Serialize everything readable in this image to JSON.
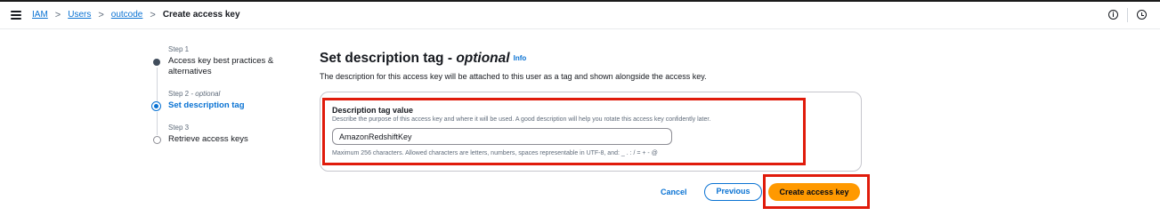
{
  "header": {
    "breadcrumbs": [
      {
        "label": "IAM"
      },
      {
        "label": "Users"
      },
      {
        "label": "outcode"
      }
    ],
    "current": "Create access key",
    "separator": ">",
    "info_icon": "i"
  },
  "steps": [
    {
      "number": "Step 1",
      "title_line1": "Access key best practices &",
      "title_line2": "alternatives",
      "state": "done"
    },
    {
      "number": "Step 2",
      "number_suffix": " - optional",
      "title": "Set description tag",
      "state": "active"
    },
    {
      "number": "Step 3",
      "title": "Retrieve access keys",
      "state": "pending"
    }
  ],
  "main": {
    "title": "Set description tag - ",
    "title_optional": "optional",
    "info": "Info",
    "description": "The description for this access key will be attached to this user as a tag and shown alongside the access key."
  },
  "field": {
    "label": "Description tag value",
    "description": "Describe the purpose of this access key and where it will be used. A good description will help you rotate this access key confidently later.",
    "value": "AmazonRedshiftKey",
    "constraint": "Maximum 256 characters. Allowed characters are letters, numbers, spaces representable in UTF-8, and: _ . : / = + - @"
  },
  "actions": {
    "cancel": "Cancel",
    "previous": "Previous",
    "create": "Create access key"
  },
  "colors": {
    "accent": "#0972d3",
    "primary_button": "#ff9900",
    "highlight": "#e01b0b"
  }
}
